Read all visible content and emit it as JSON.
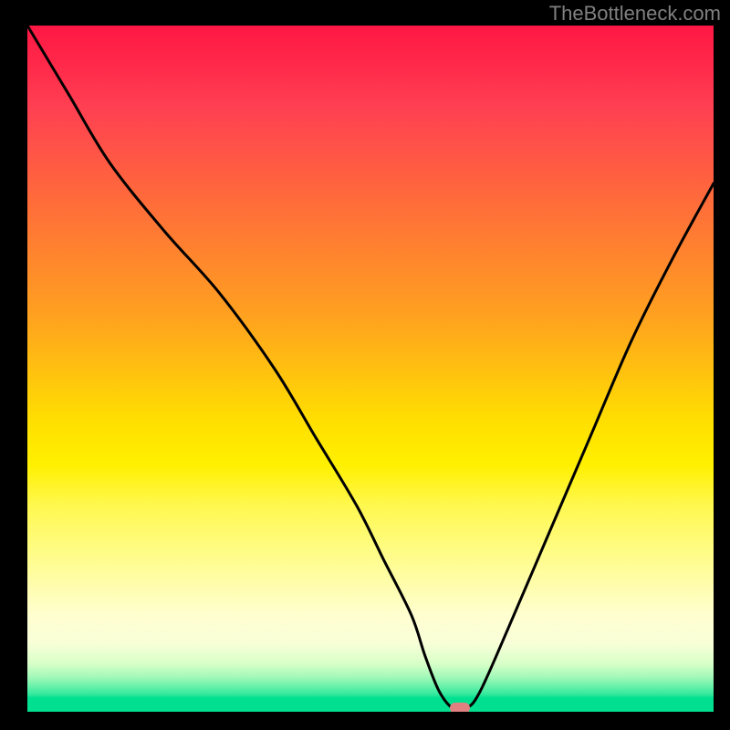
{
  "watermark": "TheBottleneck.com",
  "chart_data": {
    "type": "line",
    "title": "",
    "xlabel": "",
    "ylabel": "",
    "xlim": [
      0,
      100
    ],
    "ylim": [
      0,
      100
    ],
    "background": "vertical-gradient red-yellow-green",
    "description": "V-shaped bottleneck curve. Y-axis encodes bottleneck severity (100 = severe/red at top, 0 = none/green at bottom). X-axis is an unlabeled component-balance axis. Minimum (no bottleneck) occurs near x≈63.",
    "marker": {
      "x": 63,
      "y": 0.5,
      "color": "#e08080"
    },
    "series": [
      {
        "name": "bottleneck-curve",
        "x": [
          0,
          6,
          12,
          20,
          28,
          36,
          42,
          48,
          52,
          56,
          58,
          60,
          62,
          64,
          66,
          70,
          76,
          82,
          88,
          94,
          100
        ],
        "y": [
          100,
          90,
          80,
          70,
          61,
          50,
          40,
          30,
          22,
          14,
          8,
          3,
          0.5,
          0.5,
          3,
          12,
          26,
          40,
          54,
          66,
          77
        ]
      }
    ],
    "gradient_stops": [
      {
        "offset": 0,
        "color": "#ff1744"
      },
      {
        "offset": 50,
        "color": "#ffe000"
      },
      {
        "offset": 90,
        "color": "#fffed0"
      },
      {
        "offset": 98,
        "color": "#00e090"
      },
      {
        "offset": 100,
        "color": "#00e090"
      }
    ]
  }
}
